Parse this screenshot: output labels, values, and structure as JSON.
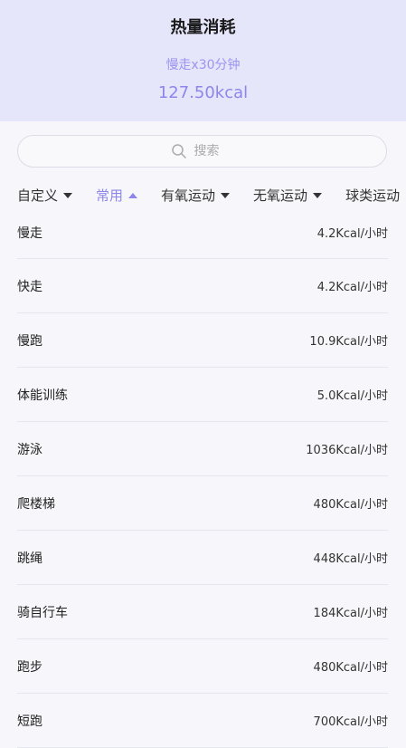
{
  "header": {
    "title": "热量消耗",
    "subtitle": "慢走x30分钟",
    "total": "127.50kcal"
  },
  "search": {
    "placeholder": "搜索"
  },
  "tabs": [
    {
      "label": "自定义",
      "active": false
    },
    {
      "label": "常用",
      "active": true
    },
    {
      "label": "有氧运动",
      "active": false
    },
    {
      "label": "无氧运动",
      "active": false
    },
    {
      "label": "球类运动",
      "active": false
    }
  ],
  "exercises": [
    {
      "name": "慢走",
      "value": "4.2Kcal/小时"
    },
    {
      "name": "快走",
      "value": "4.2Kcal/小时"
    },
    {
      "name": "慢跑",
      "value": "10.9Kcal/小时"
    },
    {
      "name": "体能训练",
      "value": "5.0Kcal/小时"
    },
    {
      "name": "游泳",
      "value": "1036Kcal/小时"
    },
    {
      "name": "爬楼梯",
      "value": "480Kcal/小时"
    },
    {
      "name": "跳绳",
      "value": "448Kcal/小时"
    },
    {
      "name": "骑自行车",
      "value": "184Kcal/小时"
    },
    {
      "name": "跑步",
      "value": "480Kcal/小时"
    },
    {
      "name": "短跑",
      "value": "700Kcal/小时"
    }
  ],
  "colors": {
    "accent": "#8c86ec",
    "header_bg": "#e6e6fb"
  },
  "icons": {
    "search": "search-icon",
    "tab_collapsed": "triangle-down-icon",
    "tab_expanded": "triangle-up-icon"
  }
}
